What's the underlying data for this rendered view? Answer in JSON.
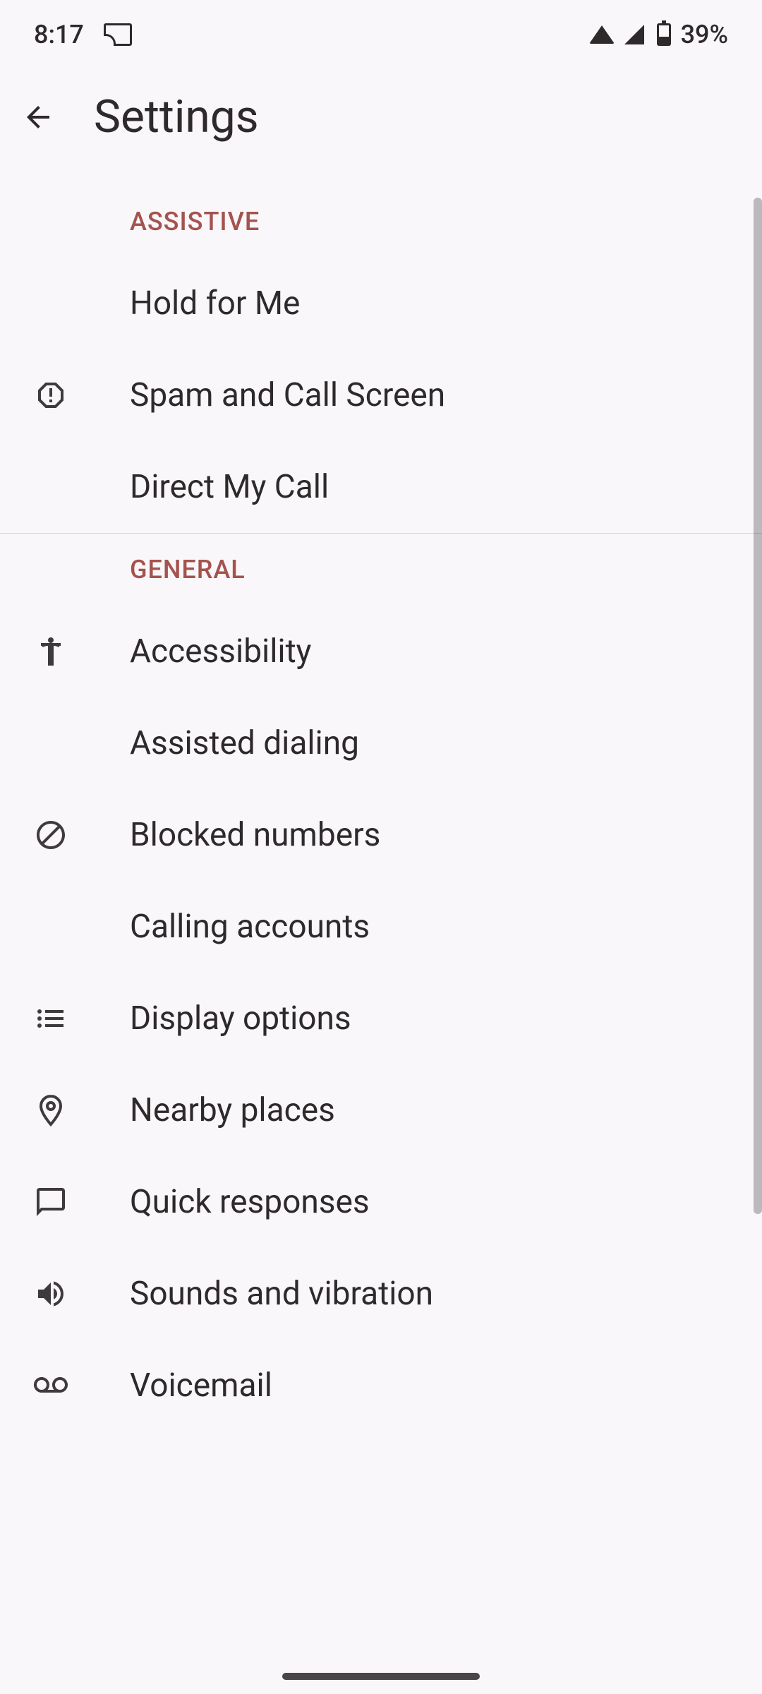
{
  "status_bar": {
    "time": "8:17",
    "battery_percent": "39%"
  },
  "header": {
    "title": "Settings"
  },
  "sections": [
    {
      "title": "ASSISTIVE",
      "items": [
        {
          "label": "Hold for Me",
          "icon": null
        },
        {
          "label": "Spam and Call Screen",
          "icon": "alert-octagon"
        },
        {
          "label": "Direct My Call",
          "icon": null
        }
      ]
    },
    {
      "title": "GENERAL",
      "items": [
        {
          "label": "Accessibility",
          "icon": "accessibility"
        },
        {
          "label": "Assisted dialing",
          "icon": null
        },
        {
          "label": "Blocked numbers",
          "icon": "block"
        },
        {
          "label": "Calling accounts",
          "icon": null
        },
        {
          "label": "Display options",
          "icon": "list"
        },
        {
          "label": "Nearby places",
          "icon": "location"
        },
        {
          "label": "Quick responses",
          "icon": "message"
        },
        {
          "label": "Sounds and vibration",
          "icon": "volume"
        },
        {
          "label": "Voicemail",
          "icon": "voicemail"
        }
      ]
    }
  ]
}
